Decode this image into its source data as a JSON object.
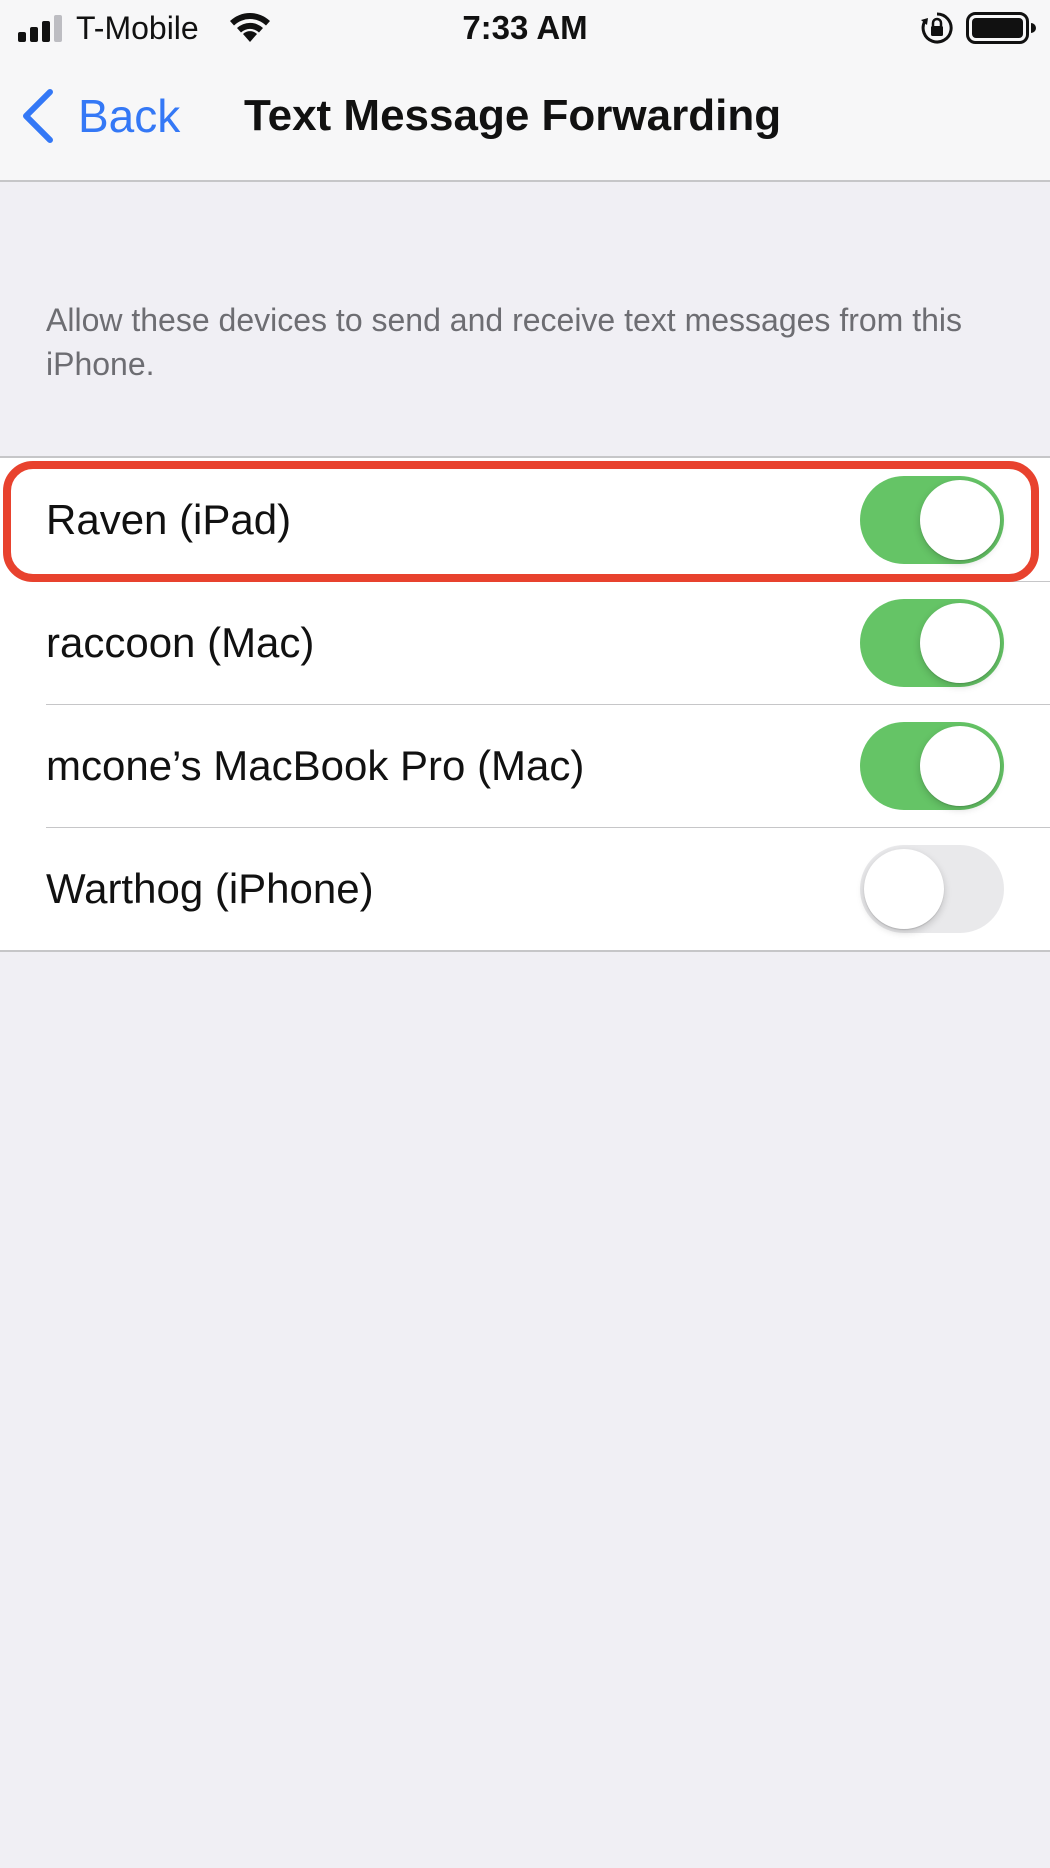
{
  "status_bar": {
    "carrier": "T-Mobile",
    "time": "7:33 AM",
    "icons": [
      "cellular-signal-icon",
      "wifi-icon",
      "orientation-lock-icon",
      "battery-icon"
    ]
  },
  "nav": {
    "back_label": "Back",
    "title": "Text Message Forwarding"
  },
  "section": {
    "footer_text": "Allow these devices to send and receive text messages from this iPhone."
  },
  "devices": [
    {
      "name": "Raven (iPad)",
      "enabled": true,
      "highlighted": true
    },
    {
      "name": "raccoon (Mac)",
      "enabled": true
    },
    {
      "name": "mcone’s MacBook Pro (Mac)",
      "enabled": true
    },
    {
      "name": "Warthog (iPhone)",
      "enabled": false
    }
  ],
  "colors": {
    "accent": "#3478f6",
    "toggle_on": "#65c466",
    "toggle_off": "#e9e9eb",
    "highlight": "#e8422e",
    "background": "#f0eff4"
  }
}
